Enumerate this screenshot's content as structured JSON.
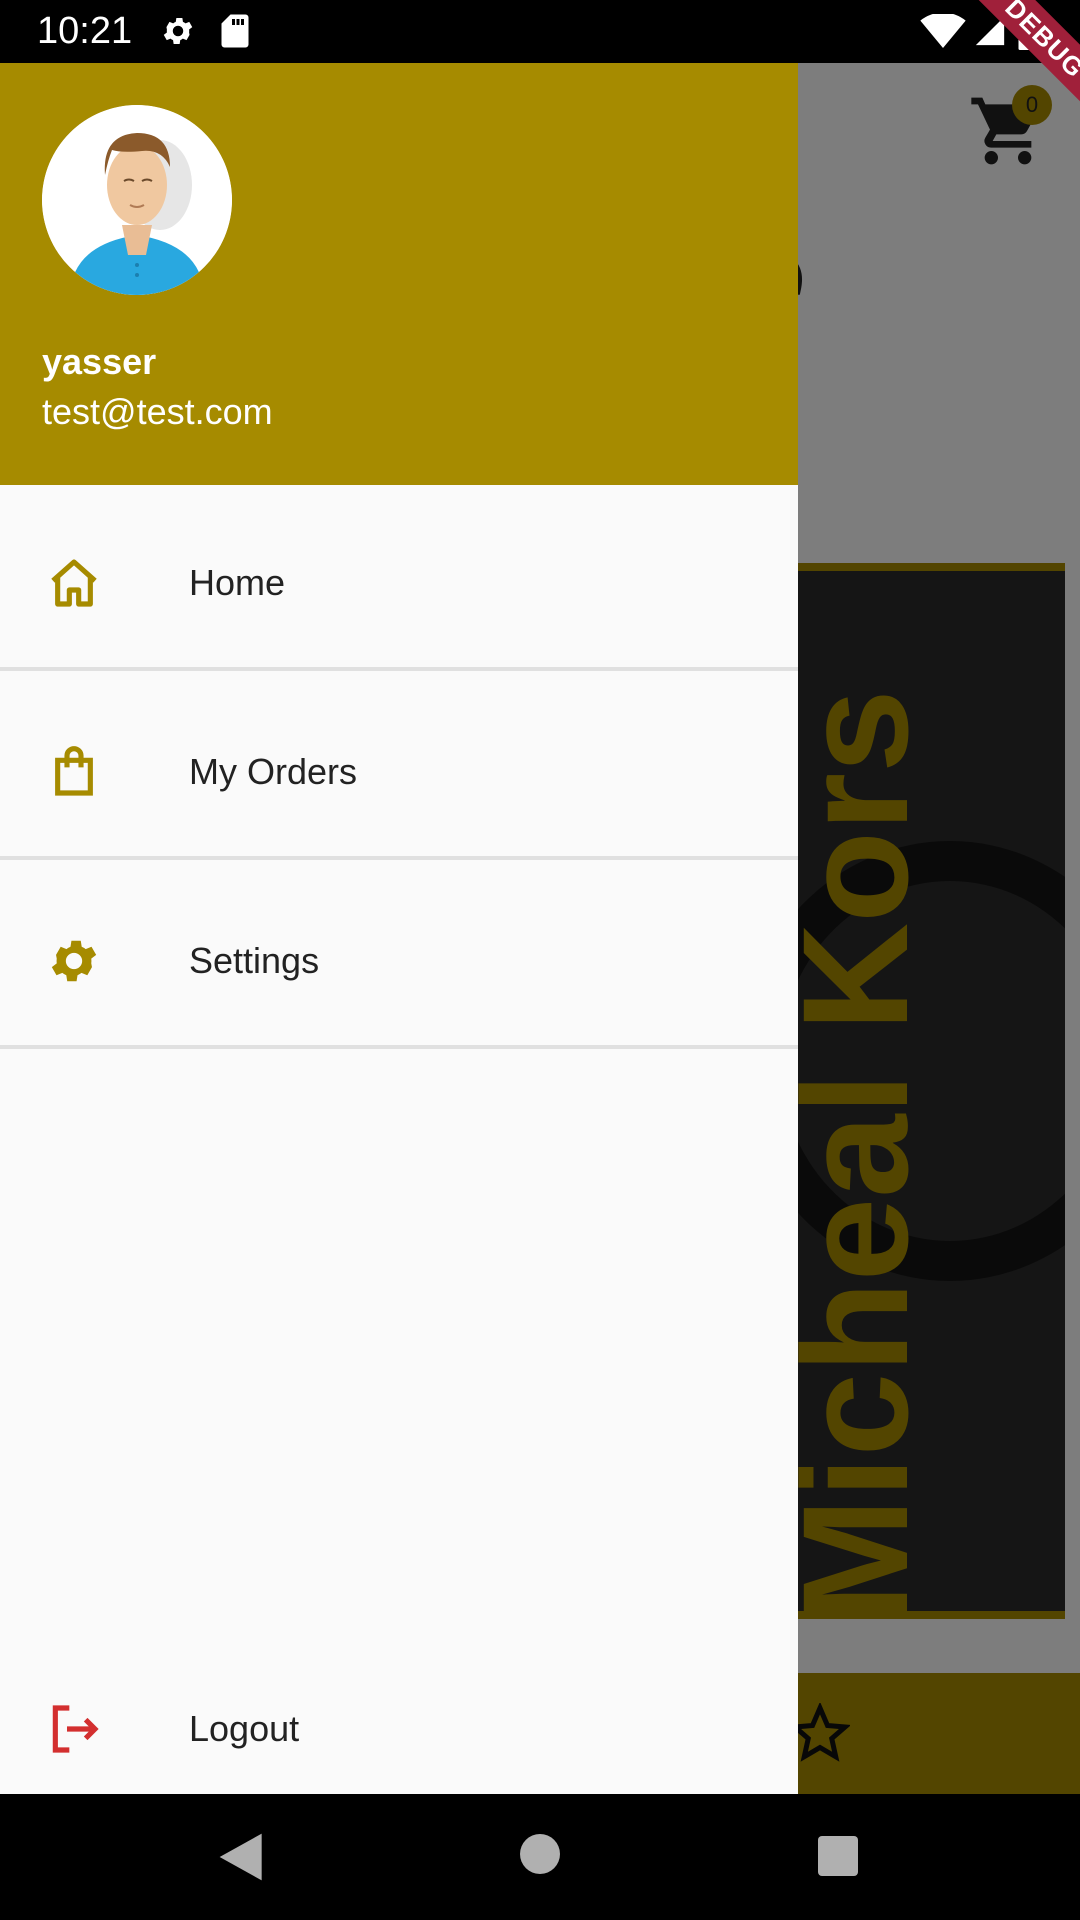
{
  "status_bar": {
    "time": "10:21"
  },
  "background_app": {
    "title_fragment": "rite",
    "cart_count": "0",
    "banner_text": "Micheal Kors",
    "debug_label": "DEBUG"
  },
  "drawer": {
    "header": {
      "name": "yasser",
      "email": "test@test.com"
    },
    "items": [
      {
        "label": "Home",
        "icon": "home-icon"
      },
      {
        "label": "My Orders",
        "icon": "shopping-bag-icon"
      },
      {
        "label": "Settings",
        "icon": "gear-icon"
      }
    ],
    "logout": {
      "label": "Logout",
      "icon": "logout-icon"
    }
  },
  "colors": {
    "accent": "#a68b00",
    "logout": "#d32f2f",
    "drawer_bg": "#fafafa"
  }
}
